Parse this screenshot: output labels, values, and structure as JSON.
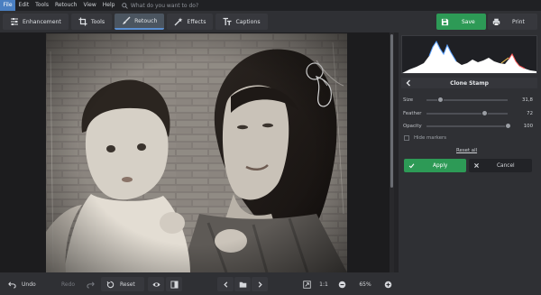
{
  "menu": {
    "items": [
      "File",
      "Edit",
      "Tools",
      "Retouch",
      "View",
      "Help"
    ],
    "search_placeholder": "What do you want to do?"
  },
  "toolbar": {
    "tabs": [
      "Enhancement",
      "Tools",
      "Retouch",
      "Effects",
      "Captions"
    ],
    "active_tab": "Retouch",
    "save_label": "Save",
    "print_label": "Print"
  },
  "panel": {
    "title": "Clone Stamp",
    "sliders": [
      {
        "label": "Size",
        "value": "31,8",
        "level": 0.17
      },
      {
        "label": "Feather",
        "value": "72",
        "level": 0.72
      },
      {
        "label": "Opacity",
        "value": "100",
        "level": 1.0
      }
    ],
    "hide_markers_label": "Hide markers",
    "reset_all_label": "Reset all",
    "apply_label": "Apply",
    "cancel_label": "Cancel"
  },
  "bottom": {
    "undo_label": "Undo",
    "redo_label": "Redo",
    "reset_label": "Reset",
    "fit_label": "1:1",
    "zoom_value": "65%"
  },
  "colors": {
    "accent_green": "#2d9a56",
    "accent_blue": "#4a7fc1",
    "panel_bg": "#2f3034"
  }
}
